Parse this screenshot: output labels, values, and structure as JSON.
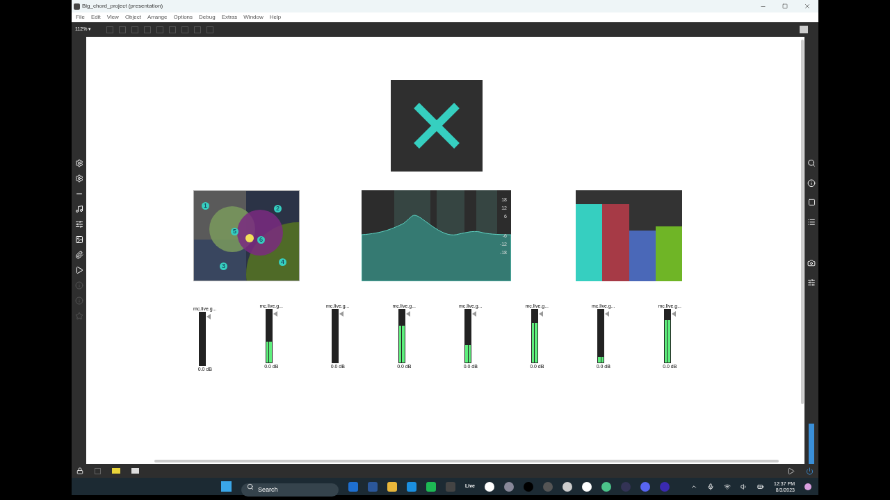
{
  "window": {
    "title": "Big_chord_project (presentation)"
  },
  "menu": [
    "File",
    "Edit",
    "View",
    "Object",
    "Arrange",
    "Options",
    "Debug",
    "Extras",
    "Window",
    "Help"
  ],
  "toolbar": {
    "zoom": "112% ▾"
  },
  "nodes": {
    "labels": [
      "1",
      "2",
      "3",
      "4",
      "5",
      "6"
    ]
  },
  "eq": {
    "ticks": [
      "18",
      "12",
      "6",
      "-6",
      "-12",
      "-18"
    ]
  },
  "multislider": {
    "bars": [
      {
        "level": 0.85,
        "color": "#36cfc0"
      },
      {
        "level": 0.85,
        "color": "#a63a46"
      },
      {
        "level": 0.56,
        "color": "#4a68b8"
      },
      {
        "level": 0.6,
        "color": "#6fb526"
      }
    ]
  },
  "meters": [
    {
      "label": "mc.live.g...",
      "level": 0,
      "reading": "0.0 dB"
    },
    {
      "label": "mc.live.g...",
      "level": 0.4,
      "reading": "0.0 dB"
    },
    {
      "label": "mc.live.g...",
      "level": 0,
      "reading": "0.0 dB"
    },
    {
      "label": "mc.live.g...",
      "level": 0.7,
      "reading": "0.0 dB"
    },
    {
      "label": "mc.live.g...",
      "level": 0.33,
      "reading": "0.0 dB"
    },
    {
      "label": "mc.live.g...",
      "level": 0.75,
      "reading": "0.0 dB"
    },
    {
      "label": "mc.live.g...",
      "level": 0.1,
      "reading": "0.0 dB"
    },
    {
      "label": "mc.live.g...",
      "level": 0.8,
      "reading": "0.0 dB"
    }
  ],
  "taskbar": {
    "search": {
      "placeholder": "Search"
    },
    "live_label": "Live",
    "time": "12:37 PM",
    "date": "8/3/2023"
  }
}
